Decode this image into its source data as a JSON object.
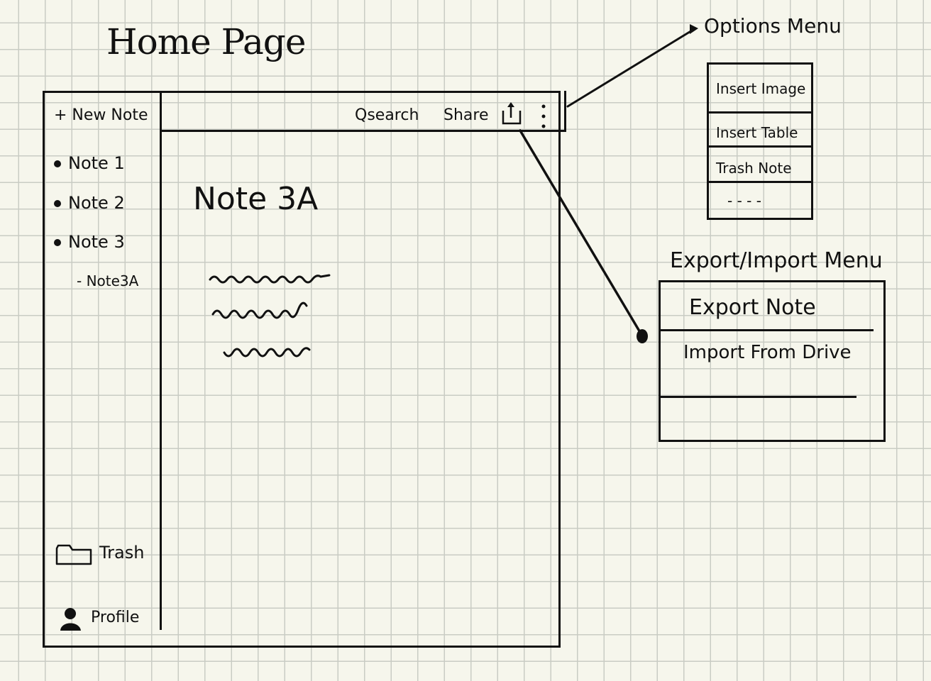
{
  "page": {
    "title": "Home Page"
  },
  "sidebar": {
    "new_note": "+ New Note",
    "notes": [
      {
        "label": "Note 1"
      },
      {
        "label": "Note 2"
      },
      {
        "label": "Note 3"
      }
    ],
    "sub_note": "- Note3A",
    "trash": "Trash",
    "profile": "Profile"
  },
  "toolbar": {
    "search": "Qsearch",
    "share": "Share"
  },
  "editor": {
    "note_title": "Note 3A"
  },
  "options_menu": {
    "label": "Options Menu",
    "items": [
      "Insert Image",
      "Insert Table",
      "Trash Note",
      "- - - -"
    ]
  },
  "export_menu": {
    "label": "Export/Import Menu",
    "items": [
      "Export Note",
      "Import From Drive"
    ]
  },
  "colors": {
    "ink": "#111111",
    "paper": "#f6f6ec",
    "grid": "#c9ccc4"
  },
  "icons": [
    "share-icon",
    "kebab-menu-icon",
    "trash-folder-icon",
    "profile-icon"
  ]
}
